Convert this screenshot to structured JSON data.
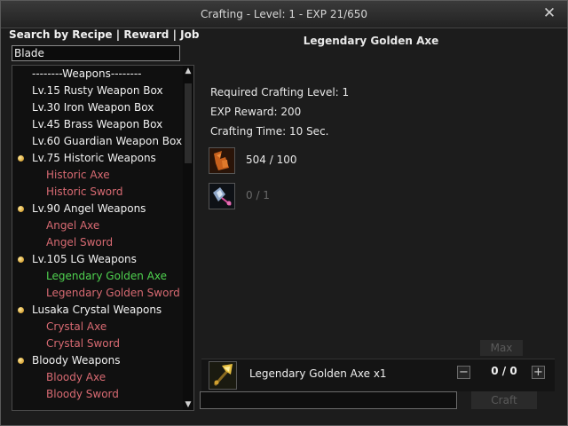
{
  "window": {
    "title": "Crafting - Level: 1 - EXP 21/650",
    "close_glyph": "✕"
  },
  "search": {
    "label_recipe": "Search by Recipe",
    "sep1": " | ",
    "label_reward": "Reward",
    "sep2": " | ",
    "label_job": "Job",
    "value": "Blade"
  },
  "list": {
    "items": [
      {
        "text": "--------Weapons--------",
        "kind": "header"
      },
      {
        "text": "Lv.15 Rusty Weapon Box",
        "kind": "lvl1"
      },
      {
        "text": "Lv.30 Iron Weapon Box",
        "kind": "lvl1"
      },
      {
        "text": "Lv.45 Brass Weapon Box",
        "kind": "lvl1"
      },
      {
        "text": "Lv.60 Guardian Weapon Box",
        "kind": "lvl1"
      },
      {
        "text": "Lv.75 Historic Weapons",
        "kind": "lvl1",
        "bullet": true
      },
      {
        "text": "Historic Axe",
        "kind": "lvl2"
      },
      {
        "text": "Historic Sword",
        "kind": "lvl2"
      },
      {
        "text": "Lv.90 Angel Weapons",
        "kind": "lvl1",
        "bullet": true
      },
      {
        "text": "Angel Axe",
        "kind": "lvl2"
      },
      {
        "text": "Angel Sword",
        "kind": "lvl2"
      },
      {
        "text": "Lv.105 LG Weapons",
        "kind": "lvl1",
        "bullet": true
      },
      {
        "text": "Legendary Golden Axe",
        "kind": "lvl2",
        "selected": true
      },
      {
        "text": "Legendary Golden Sword",
        "kind": "lvl2"
      },
      {
        "text": "Lusaka Crystal Weapons",
        "kind": "lvl1",
        "bullet": true
      },
      {
        "text": "Crystal Axe",
        "kind": "lvl2"
      },
      {
        "text": "Crystal Sword",
        "kind": "lvl2"
      },
      {
        "text": "Bloody Weapons",
        "kind": "lvl1",
        "bullet": true
      },
      {
        "text": "Bloody Axe",
        "kind": "lvl2"
      },
      {
        "text": "Bloody Sword",
        "kind": "lvl2"
      }
    ]
  },
  "recipe": {
    "title": "Legendary Golden Axe",
    "required_level": "Required Crafting Level: 1",
    "exp_reward": "EXP Reward: 200",
    "crafting_time": "Crafting Time: 10 Sec.",
    "materials": [
      {
        "icon": "leather-material-icon",
        "qty": "504 / 100",
        "color": "#e8e8e8"
      },
      {
        "icon": "crystal-gem-icon",
        "qty": "0 / 1",
        "color": "#6a6a6a"
      }
    ]
  },
  "result": {
    "icon": "golden-axe-icon",
    "name": "Legendary Golden Axe x1",
    "qty": "0 / 0",
    "minus": "−",
    "plus": "+",
    "max_label": "Max",
    "craft_label": "Craft"
  }
}
